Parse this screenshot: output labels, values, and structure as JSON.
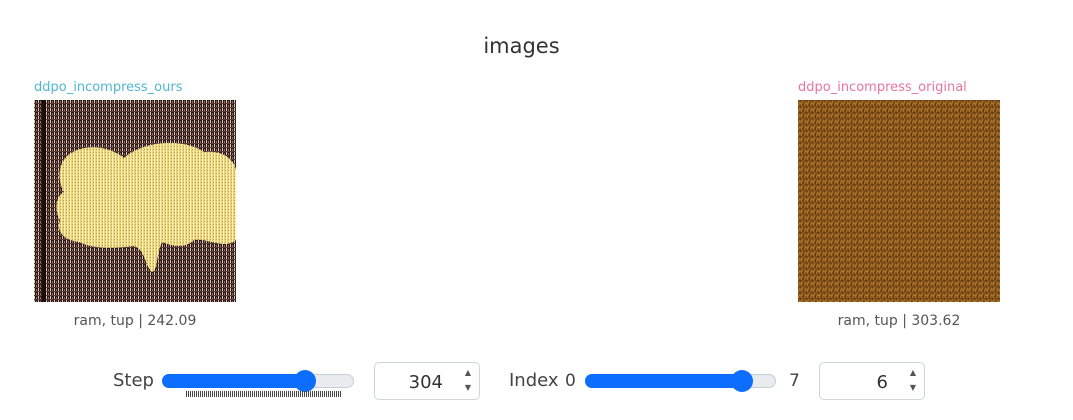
{
  "panel": {
    "title": "images"
  },
  "images": [
    {
      "run": "ddpo_incompress_ours",
      "caption": "ram, tup | 242.09",
      "run_color": "#4fb6d2"
    },
    {
      "run": "ddpo_incompress_original",
      "caption": "ram, tup | 303.62",
      "run_color": "#e8749f"
    }
  ],
  "controls": {
    "step": {
      "label": "Step",
      "value": "304",
      "slider_fraction": 0.88
    },
    "index": {
      "label": "Index",
      "min": "0",
      "max": "7",
      "value": "6",
      "slider_fraction": 0.857
    }
  },
  "icons": {
    "spin_up": "▲",
    "spin_down": "▼"
  },
  "colors": {
    "accent": "#0d6efd",
    "track": "#e9ecef"
  }
}
